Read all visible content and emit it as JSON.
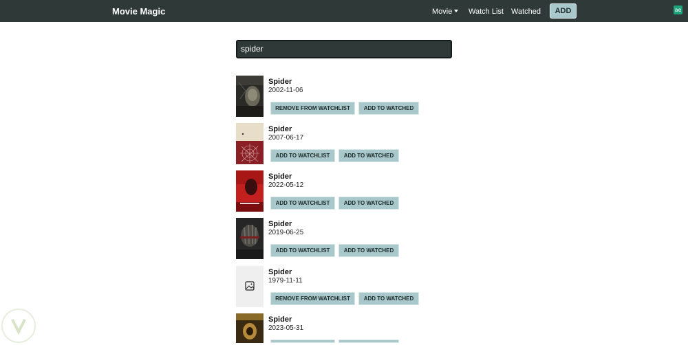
{
  "navbar": {
    "brand": "Movie Magic",
    "links": {
      "movie": "Movie",
      "watch_list": "Watch List",
      "watched": "Watched"
    },
    "add_label": "ADD",
    "corner_icon": "ae"
  },
  "search": {
    "value": "spider"
  },
  "actions": {
    "add_watchlist": "ADD TO WATCHLIST",
    "remove_watchlist": "REMOVE FROM WATCHLIST",
    "add_watched": "ADD TO WATCHED"
  },
  "results": [
    {
      "title": "Spider",
      "date": "2002-11-06",
      "in_watchlist": true,
      "poster": "dark-portrait"
    },
    {
      "title": "Spider",
      "date": "2007-06-17",
      "in_watchlist": false,
      "poster": "cream-red-web"
    },
    {
      "title": "Spider",
      "date": "2022-05-12",
      "in_watchlist": false,
      "poster": "red-title"
    },
    {
      "title": "Spider",
      "date": "2019-06-25",
      "in_watchlist": false,
      "poster": "dark-hand"
    },
    {
      "title": "Spider",
      "date": "1979-11-11",
      "in_watchlist": true,
      "poster": "image-placeholder-icon"
    },
    {
      "title": "Spider",
      "date": "2023-05-31",
      "in_watchlist": false,
      "poster": "gold-dark"
    }
  ],
  "colors": {
    "navbar_bg": "#2f3a38",
    "button_bg": "#a8c8cb",
    "search_bg": "#2f3a38"
  }
}
